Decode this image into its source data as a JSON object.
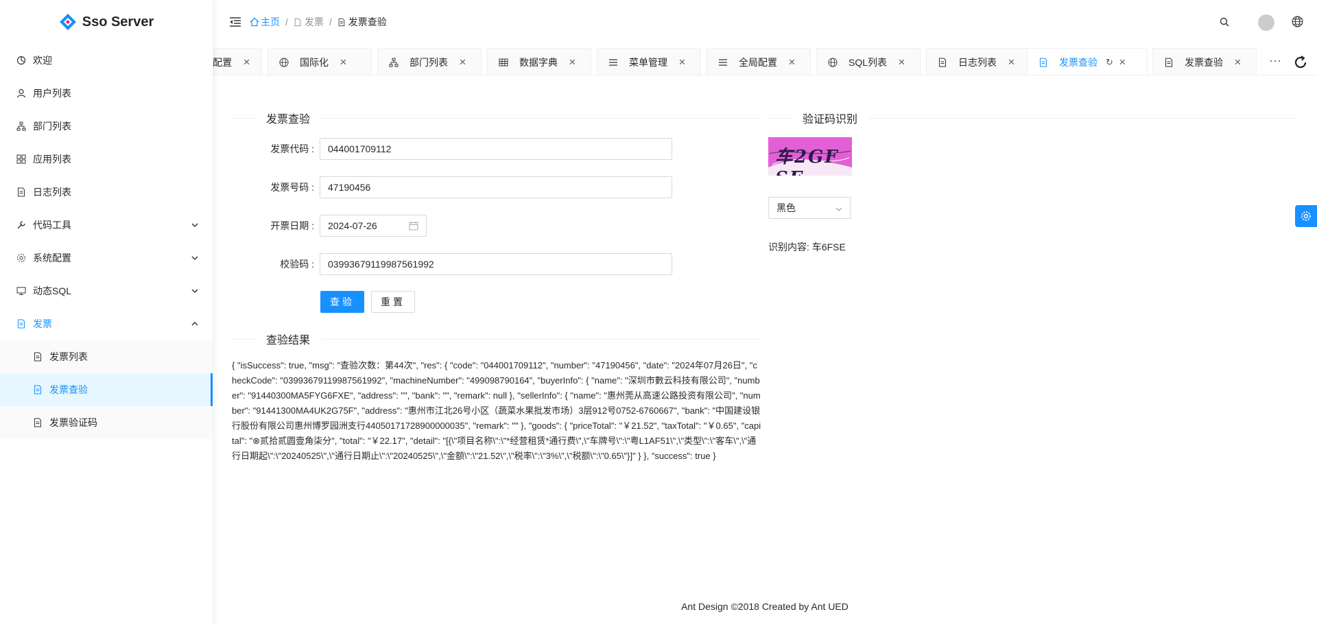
{
  "app": {
    "title": "Sso Server"
  },
  "colors": {
    "primary": "#1890ff",
    "captcha_bg": "#e35fd8"
  },
  "sidebar": {
    "items": [
      {
        "label": "欢迎",
        "icon": "dashboard-icon"
      },
      {
        "label": "用户列表",
        "icon": "user-icon"
      },
      {
        "label": "部门列表",
        "icon": "cluster-icon"
      },
      {
        "label": "应用列表",
        "icon": "apps-icon"
      },
      {
        "label": "日志列表",
        "icon": "file-icon"
      },
      {
        "label": "代码工具",
        "icon": "tool-icon"
      },
      {
        "label": "系统配置",
        "icon": "setting-icon"
      },
      {
        "label": "动态SQL",
        "icon": "monitor-icon"
      },
      {
        "label": "发票",
        "icon": "file-text-icon"
      }
    ],
    "sub_items": [
      {
        "label": "发票列表"
      },
      {
        "label": "发票查验"
      },
      {
        "label": "发票验证码"
      }
    ]
  },
  "breadcrumb": {
    "home": "主页",
    "mid": "发票",
    "current": "发票查验"
  },
  "tabs": [
    {
      "label": "配置",
      "icon": ""
    },
    {
      "label": "国际化",
      "icon": "globe-icon"
    },
    {
      "label": "部门列表",
      "icon": "cluster-icon"
    },
    {
      "label": "数据字典",
      "icon": "table-icon"
    },
    {
      "label": "菜单管理",
      "icon": "menu-icon"
    },
    {
      "label": "全局配置",
      "icon": "menu-icon"
    },
    {
      "label": "SQL列表",
      "icon": "globe-icon"
    },
    {
      "label": "日志列表",
      "icon": "file-icon"
    },
    {
      "label": "发票查验",
      "icon": "file-text-icon",
      "active": true
    },
    {
      "label": "发票查验",
      "icon": "file-icon"
    }
  ],
  "tabs_more": "···",
  "form": {
    "section_title": "发票查验",
    "code_label": "发票代码",
    "code_value": "044001709112",
    "number_label": "发票号码",
    "number_value": "47190456",
    "date_label": "开票日期",
    "date_value": "2024-07-26",
    "check_label": "校验码",
    "check_value": "03993679119987561992",
    "submit_label": "查验",
    "reset_label": "重置"
  },
  "result": {
    "section_title": "查验结果",
    "text": "{ \"isSuccess\": true, \"msg\": \"查验次数：第44次\", \"res\": { \"code\": \"044001709112\", \"number\": \"47190456\", \"date\": \"2024年07月26日\", \"checkCode\": \"03993679119987561992\", \"machineNumber\": \"499098790164\", \"buyerInfo\": { \"name\": \"深圳市數云科技有限公司\", \"number\": \"91440300MA5FYG6FXE\", \"address\": \"\", \"bank\": \"\", \"remark\": null }, \"sellerInfo\": { \"name\": \"惠州莞从高速公路投资有限公司\", \"number\": \"91441300MA4UK2G75F\", \"address\": \"惠州市江北26号小区（蔬菜水果批发市场）3层912号0752-6760667\", \"bank\": \"中国建设银行股份有限公司惠州博罗园洲支行44050171728900000035\", \"remark\": \"\" }, \"goods\": { \"priceTotal\": \"￥21.52\", \"taxTotal\": \"￥0.65\", \"capital\": \"⊗贰拾贰圆壹角柒分\", \"total\": \"￥22.17\", \"detail\": \"[{\\\"项目名称\\\":\\\"*经营租赁*通行费\\\",\\\"车牌号\\\":\\\"粤L1AF51\\\",\\\"类型\\\":\\\"客车\\\",\\\"通行日期起\\\":\\\"20240525\\\",\\\"通行日期止\\\":\\\"20240525\\\",\\\"金额\\\":\\\"21.52\\\",\\\"税率\\\":\\\"3%\\\",\\\"税额\\\":\\\"0.65\\\"}]\" } }, \"success\": true }"
  },
  "captcha": {
    "section_title": "验证码识别",
    "image_text": "车2GF SE",
    "color_select": "黑色",
    "ocr_label": "识别内容:",
    "ocr_value": "车6FSE"
  },
  "footer": {
    "text": "Ant Design ©2018 Created by Ant UED"
  }
}
